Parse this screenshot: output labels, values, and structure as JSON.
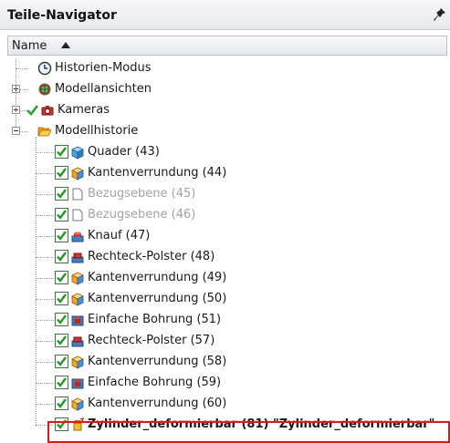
{
  "panel": {
    "title": "Teile-Navigator",
    "pin_icon": "pin-icon"
  },
  "column": {
    "name": "Name",
    "sort": "ascending"
  },
  "tree": [
    {
      "label": "Historien-Modus",
      "icon": "clock-icon",
      "level": 0,
      "expander": "none",
      "checked": null,
      "dim": false
    },
    {
      "label": "Modellansichten",
      "icon": "model-views-icon",
      "level": 0,
      "expander": "plus",
      "checked": null,
      "dim": false
    },
    {
      "label": "Kameras",
      "icon": "camera-icon",
      "level": 0,
      "expander": "plus",
      "checked": true,
      "dim": false
    },
    {
      "label": "Modellhistorie",
      "icon": "open-folder-icon",
      "level": 0,
      "expander": "minus",
      "checked": null,
      "dim": false
    },
    {
      "label": "Quader (43)",
      "icon": "block-icon",
      "level": 1,
      "checked": true,
      "dim": false
    },
    {
      "label": "Kantenverrundung (44)",
      "icon": "edge-blend-icon",
      "level": 1,
      "checked": true,
      "dim": false
    },
    {
      "label": "Bezugsebene (45)",
      "icon": "datum-plane-icon",
      "level": 1,
      "checked": true,
      "dim": true
    },
    {
      "label": "Bezugsebene (46)",
      "icon": "datum-plane-icon",
      "level": 1,
      "checked": true,
      "dim": true
    },
    {
      "label": "Knauf (47)",
      "icon": "boss-icon",
      "level": 1,
      "checked": true,
      "dim": false
    },
    {
      "label": "Rechteck-Polster (48)",
      "icon": "pad-icon",
      "level": 1,
      "checked": true,
      "dim": false
    },
    {
      "label": "Kantenverrundung (49)",
      "icon": "edge-blend-icon",
      "level": 1,
      "checked": true,
      "dim": false
    },
    {
      "label": "Kantenverrundung (50)",
      "icon": "edge-blend-icon",
      "level": 1,
      "checked": true,
      "dim": false
    },
    {
      "label": "Einfache Bohrung (51)",
      "icon": "hole-icon",
      "level": 1,
      "checked": true,
      "dim": false
    },
    {
      "label": "Rechteck-Polster (57)",
      "icon": "pad-icon",
      "level": 1,
      "checked": true,
      "dim": false
    },
    {
      "label": "Kantenverrundung (58)",
      "icon": "edge-blend-icon",
      "level": 1,
      "checked": true,
      "dim": false
    },
    {
      "label": "Einfache Bohrung (59)",
      "icon": "hole-icon",
      "level": 1,
      "checked": true,
      "dim": false
    },
    {
      "label": "Kantenverrundung (60)",
      "icon": "edge-blend-icon",
      "level": 1,
      "checked": true,
      "dim": false
    },
    {
      "label": "Zylinder_deformierbar (81) \"Zylinder_deformierbar\"",
      "icon": "deformable-cylinder-icon",
      "level": 1,
      "checked": true,
      "dim": false,
      "selected": true
    }
  ],
  "colors": {
    "check_green": "#2e9e2e",
    "selection_border": "#e01818",
    "dim_text": "#a3a3a3",
    "folder": "#f5b21b"
  }
}
